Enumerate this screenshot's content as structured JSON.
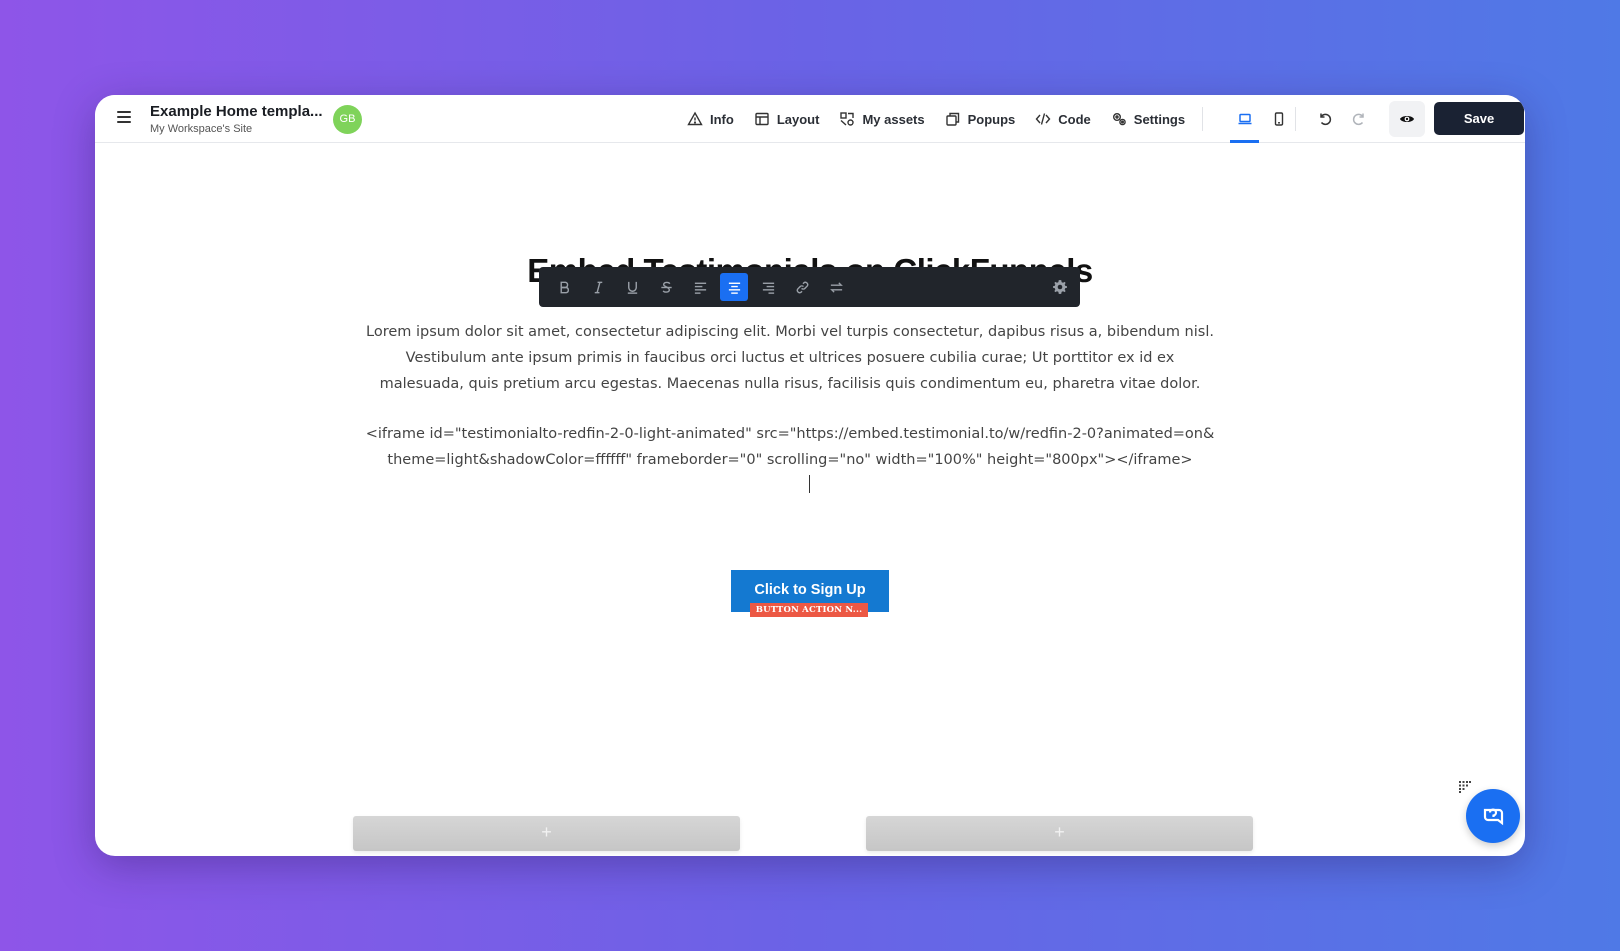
{
  "header": {
    "site_title": "Example Home templa...",
    "site_subtitle": "My Workspace's Site",
    "avatar_initials": "GB",
    "nav": [
      {
        "label": "Info",
        "icon": "warning-triangle-icon"
      },
      {
        "label": "Layout",
        "icon": "layout-icon"
      },
      {
        "label": "My assets",
        "icon": "assets-icon"
      },
      {
        "label": "Popups",
        "icon": "popups-icon"
      },
      {
        "label": "Code",
        "icon": "code-icon"
      },
      {
        "label": "Settings",
        "icon": "settings-icon"
      }
    ],
    "devices": {
      "active": "desktop",
      "options": [
        "desktop",
        "mobile"
      ]
    },
    "save_label": "Save"
  },
  "editor": {
    "heading": "Embed Testimonials on ClickFunnels",
    "paragraph": "Lorem ipsum dolor sit amet, consectetur adipiscing elit. Morbi vel turpis consectetur, dapibus risus a, bibendum nisl. Vestibulum ante ipsum primis in faucibus orci luctus et ultrices posuere cubilia curae; Ut porttitor ex id ex malesuada, quis pretium arcu egestas. Maecenas nulla risus, facilisis quis condimentum eu, pharetra vitae dolor.",
    "embed_code": "<iframe id=\"testimonialto-redfin-2-0-light-animated\" src=\"https://embed.testimonial.to/w/redfin-2-0?animated=on&theme=light&shadowColor=ffffff\" frameborder=\"0\" scrolling=\"no\" width=\"100%\" height=\"800px\"></iframe>",
    "cta_label": "Click to Sign Up",
    "cta_tag": "BUTTON ACTION N...",
    "add_section_label": "+"
  },
  "toolbar": {
    "buttons": [
      "bold",
      "italic",
      "underline",
      "strikethrough",
      "align-left",
      "align-center",
      "align-right",
      "link",
      "swap"
    ],
    "active": "align-center"
  },
  "colors": {
    "accent": "#1a6ff2",
    "save_button": "#1a2233",
    "cta": "#1479d1",
    "cta_tag": "#ec5844",
    "avatar": "#7fd35a"
  }
}
